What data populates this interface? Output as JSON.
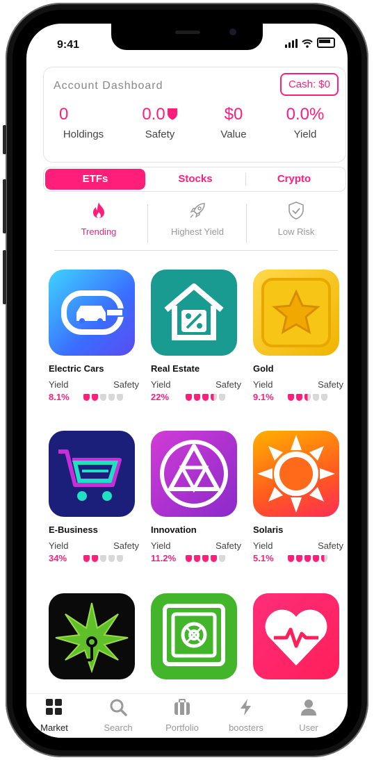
{
  "status_bar": {
    "time": "9:41"
  },
  "dashboard": {
    "title": "Account Dashboard",
    "cash_button": "Cash: $0",
    "stats": [
      {
        "value": "0",
        "label": "Holdings"
      },
      {
        "value": "0.0",
        "label": "Safety"
      },
      {
        "value": "$0",
        "label": "Value"
      },
      {
        "value": "0.0%",
        "label": "Yield"
      }
    ]
  },
  "tabs": [
    {
      "label": "ETFs",
      "active": true
    },
    {
      "label": "Stocks",
      "active": false
    },
    {
      "label": "Crypto",
      "active": false
    }
  ],
  "filters": [
    {
      "label": "Trending",
      "icon": "flame-icon",
      "active": true
    },
    {
      "label": "Highest Yield",
      "icon": "rocket-icon",
      "active": false
    },
    {
      "label": "Low Risk",
      "icon": "shield-check-icon",
      "active": false
    }
  ],
  "cards": [
    {
      "name": "Electric Cars",
      "yield_label": "Yield",
      "safety_label": "Safety",
      "yield": "8.1%",
      "safety": 2,
      "icon": "electric-car-icon"
    },
    {
      "name": "Real Estate",
      "yield_label": "Yield",
      "safety_label": "Safety",
      "yield": "22%",
      "safety": 3.5,
      "icon": "house-percent-icon"
    },
    {
      "name": "Gold",
      "yield_label": "Yield",
      "safety_label": "Safety",
      "yield": "9.1%",
      "safety": 2.5,
      "icon": "gold-star-icon"
    },
    {
      "name": "E-Business",
      "yield_label": "Yield",
      "safety_label": "Safety",
      "yield": "34%",
      "safety": 2,
      "icon": "shopping-cart-icon"
    },
    {
      "name": "Innovation",
      "yield_label": "Yield",
      "safety_label": "Safety",
      "yield": "11.2%",
      "safety": 4,
      "icon": "triangle-circle-icon"
    },
    {
      "name": "Solaris",
      "yield_label": "Yield",
      "safety_label": "Safety",
      "yield": "5.1%",
      "safety": 4.5,
      "icon": "sun-icon"
    },
    {
      "name": "",
      "icon": "cannabis-leaf-icon"
    },
    {
      "name": "",
      "icon": "safe-vault-icon"
    },
    {
      "name": "",
      "icon": "heart-pulse-icon"
    }
  ],
  "nav": [
    {
      "label": "Market",
      "icon": "grid-icon",
      "active": true
    },
    {
      "label": "Search",
      "icon": "search-icon",
      "active": false
    },
    {
      "label": "Portfolio",
      "icon": "briefcase-icon",
      "active": false
    },
    {
      "label": "boosters",
      "icon": "lightning-icon",
      "active": false
    },
    {
      "label": "User",
      "icon": "user-icon",
      "active": false
    }
  ],
  "colors": {
    "accent": "#ff1f7a",
    "inactive_shield": "#d8d8d8",
    "nav_inactive": "#999999"
  }
}
